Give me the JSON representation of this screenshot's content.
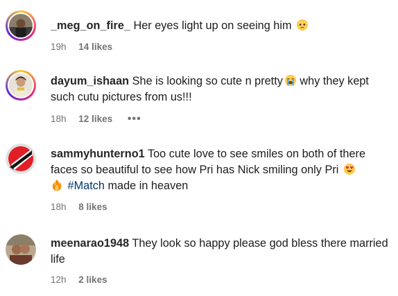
{
  "comments": [
    {
      "username": "_meg_on_fire_",
      "text": "Her eyes light up on seeing him",
      "emoji": "pleading-face",
      "time": "19h",
      "likes": "14 likes",
      "story_ring": true
    },
    {
      "username": "dayum_ishaan",
      "text_before": "She is looking so cute n pretty",
      "emoji": "loudly-crying-face",
      "text_after": "why they kept such cutu pictures from us!!!",
      "time": "18h",
      "likes": "12 likes",
      "more": "•••",
      "story_ring": true
    },
    {
      "username": "sammyhunterno1",
      "text_before": "Too cute love to see smiles on both of there faces so beautiful to see how Pri has Nick smiling only Pri",
      "emoji": "heart-eyes",
      "emoji2": "fire",
      "hashtag": "#Match",
      "text_after": "made in heaven",
      "time": "18h",
      "likes": "8 likes",
      "story_ring": false
    },
    {
      "username": "meenarao1948",
      "text": "They look so happy please god bless there married life",
      "time": "12h",
      "likes": "2 likes",
      "story_ring": false
    }
  ],
  "colors": {
    "story_ring_start": "#f9ce34",
    "story_ring_mid": "#ee2a7b",
    "story_ring_end": "#6228d7",
    "meta_text": "#737373",
    "hashtag": "#00376b"
  }
}
